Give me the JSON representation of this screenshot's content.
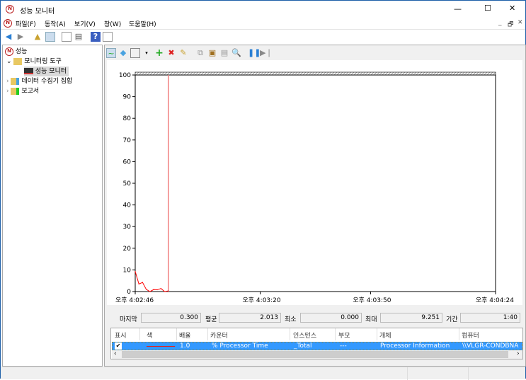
{
  "window": {
    "title": "성능 모니터",
    "controls": [
      "—",
      "☐",
      "✕"
    ],
    "inner_controls": [
      "_",
      "🗗",
      "✕"
    ]
  },
  "menu": [
    "파일(F)",
    "동작(A)",
    "보기(V)",
    "창(W)",
    "도움말(H)"
  ],
  "tree": {
    "root": "성능",
    "items": [
      {
        "label": "모니터링 도구",
        "expanded": true
      },
      {
        "label": "성능 모니터",
        "selected": true
      },
      {
        "label": "데이터 수집기 집합"
      },
      {
        "label": "보고서"
      }
    ]
  },
  "stats": {
    "last_label": "마지막",
    "last": "0.300",
    "avg_label": "평균",
    "avg": "2.013",
    "min_label": "최소",
    "min": "0.000",
    "max_label": "최대",
    "max": "9.251",
    "duration_label": "기간",
    "duration": "1:40"
  },
  "table": {
    "headers": [
      "표시",
      "색",
      "배율",
      "카운터",
      "인스턴스",
      "부모",
      "개체",
      "컴퓨터"
    ],
    "rows": [
      {
        "show": true,
        "color": "#e02020",
        "scale": "1.0",
        "counter": "% Processor Time",
        "instance": "_Total",
        "parent": "---",
        "object": "Processor Information",
        "computer": "\\\\VLGR-CONDBNA"
      }
    ]
  },
  "chart_data": {
    "type": "line",
    "ylim": [
      0,
      100
    ],
    "yticks": [
      "0",
      "10",
      "20",
      "30",
      "40",
      "50",
      "60",
      "70",
      "80",
      "90",
      "100"
    ],
    "xticks": [
      "오후 4:02:46",
      "오후 4:03:20",
      "오후 4:03:50",
      "오후 4:04:24"
    ],
    "x": [
      "4:02:46",
      "4:02:47",
      "4:02:48",
      "4:02:49",
      "4:02:50",
      "4:02:51",
      "4:02:52",
      "4:02:53",
      "4:02:54",
      "4:02:55"
    ],
    "series": [
      {
        "color": "#ff0000",
        "values": [
          9.251,
          3.5,
          4.2,
          1.0,
          0.0,
          0.9,
          0.8,
          1.4,
          0.0,
          0.3
        ]
      }
    ],
    "grid": false,
    "current_marker": "4:02:55"
  }
}
